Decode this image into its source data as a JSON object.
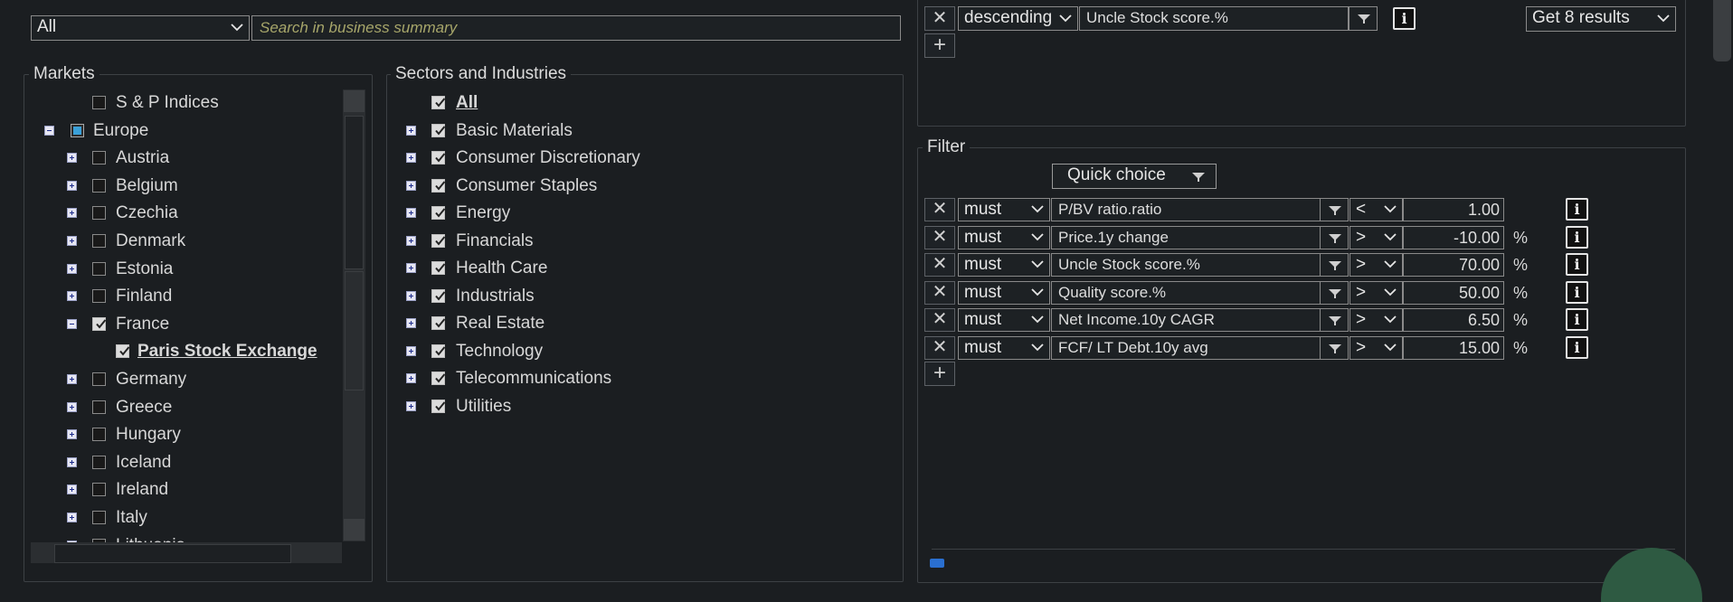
{
  "top": {
    "scope_select": "All",
    "search_placeholder": "Search in business summary"
  },
  "markets": {
    "legend": "Markets",
    "items": [
      {
        "label": "S & P Indices",
        "level": 1,
        "checked": false,
        "expander": "none",
        "bold": false
      },
      {
        "label": "Europe",
        "level": 0,
        "checked": "partial",
        "expander": "minus",
        "bold": false
      },
      {
        "label": "Austria",
        "level": 1,
        "checked": false,
        "expander": "plus",
        "bold": false
      },
      {
        "label": "Belgium",
        "level": 1,
        "checked": false,
        "expander": "plus",
        "bold": false
      },
      {
        "label": "Czechia",
        "level": 1,
        "checked": false,
        "expander": "plus",
        "bold": false
      },
      {
        "label": "Denmark",
        "level": 1,
        "checked": false,
        "expander": "plus",
        "bold": false
      },
      {
        "label": "Estonia",
        "level": 1,
        "checked": false,
        "expander": "plus",
        "bold": false
      },
      {
        "label": "Finland",
        "level": 1,
        "checked": false,
        "expander": "plus",
        "bold": false
      },
      {
        "label": "France",
        "level": 1,
        "checked": true,
        "expander": "minus",
        "bold": false
      },
      {
        "label": "Paris Stock Exchange",
        "level": 2,
        "checked": true,
        "expander": "none",
        "bold": true
      },
      {
        "label": "Germany",
        "level": 1,
        "checked": false,
        "expander": "plus",
        "bold": false
      },
      {
        "label": "Greece",
        "level": 1,
        "checked": false,
        "expander": "plus",
        "bold": false
      },
      {
        "label": "Hungary",
        "level": 1,
        "checked": false,
        "expander": "plus",
        "bold": false
      },
      {
        "label": "Iceland",
        "level": 1,
        "checked": false,
        "expander": "plus",
        "bold": false
      },
      {
        "label": "Ireland",
        "level": 1,
        "checked": false,
        "expander": "plus",
        "bold": false
      },
      {
        "label": "Italy",
        "level": 1,
        "checked": false,
        "expander": "plus",
        "bold": false
      },
      {
        "label": "Lithuania",
        "level": 1,
        "checked": false,
        "expander": "minus",
        "bold": false
      }
    ]
  },
  "sectors": {
    "legend": "Sectors and Industries",
    "items": [
      {
        "label": "All",
        "checked": true,
        "expander": "none",
        "bold": true
      },
      {
        "label": "Basic Materials",
        "checked": true,
        "expander": "plus",
        "bold": false
      },
      {
        "label": "Consumer Discretionary",
        "checked": true,
        "expander": "plus",
        "bold": false
      },
      {
        "label": "Consumer Staples",
        "checked": true,
        "expander": "plus",
        "bold": false
      },
      {
        "label": "Energy",
        "checked": true,
        "expander": "plus",
        "bold": false
      },
      {
        "label": "Financials",
        "checked": true,
        "expander": "plus",
        "bold": false
      },
      {
        "label": "Health Care",
        "checked": true,
        "expander": "plus",
        "bold": false
      },
      {
        "label": "Industrials",
        "checked": true,
        "expander": "plus",
        "bold": false
      },
      {
        "label": "Real Estate",
        "checked": true,
        "expander": "plus",
        "bold": false
      },
      {
        "label": "Technology",
        "checked": true,
        "expander": "plus",
        "bold": false
      },
      {
        "label": "Telecommunications",
        "checked": true,
        "expander": "plus",
        "bold": false
      },
      {
        "label": "Utilities",
        "checked": true,
        "expander": "plus",
        "bold": false
      }
    ]
  },
  "sort": {
    "order": "descending",
    "field": "Uncle Stock score.%",
    "results": "Get 8 results"
  },
  "filter": {
    "legend": "Filter",
    "quick_choice": "Quick choice",
    "rows": [
      {
        "mode": "must",
        "field": "P/BV ratio.ratio",
        "op": "<",
        "value": "1.00",
        "unit": ""
      },
      {
        "mode": "must",
        "field": "Price.1y change",
        "op": ">",
        "value": "-10.00",
        "unit": "%"
      },
      {
        "mode": "must",
        "field": "Uncle Stock score.%",
        "op": ">",
        "value": "70.00",
        "unit": "%"
      },
      {
        "mode": "must",
        "field": "Quality score.%",
        "op": ">",
        "value": "50.00",
        "unit": "%"
      },
      {
        "mode": "must",
        "field": "Net Income.10y CAGR",
        "op": ">",
        "value": "6.50",
        "unit": "%"
      },
      {
        "mode": "must",
        "field": "FCF/ LT Debt.10y avg",
        "op": ">",
        "value": "15.00",
        "unit": "%"
      }
    ]
  },
  "icons": {
    "remove": "close-icon",
    "add": "plus-icon",
    "info": "info-icon",
    "funnel": "funnel-icon",
    "chevron": "chevron-down-icon"
  },
  "colors": {
    "background": "#1b1e21",
    "text": "#d8d8d8",
    "border": "#8a8a8a",
    "expander": "#1b2a8a",
    "partial": "#3aa0d8",
    "accent_green": "#2e5a42"
  }
}
